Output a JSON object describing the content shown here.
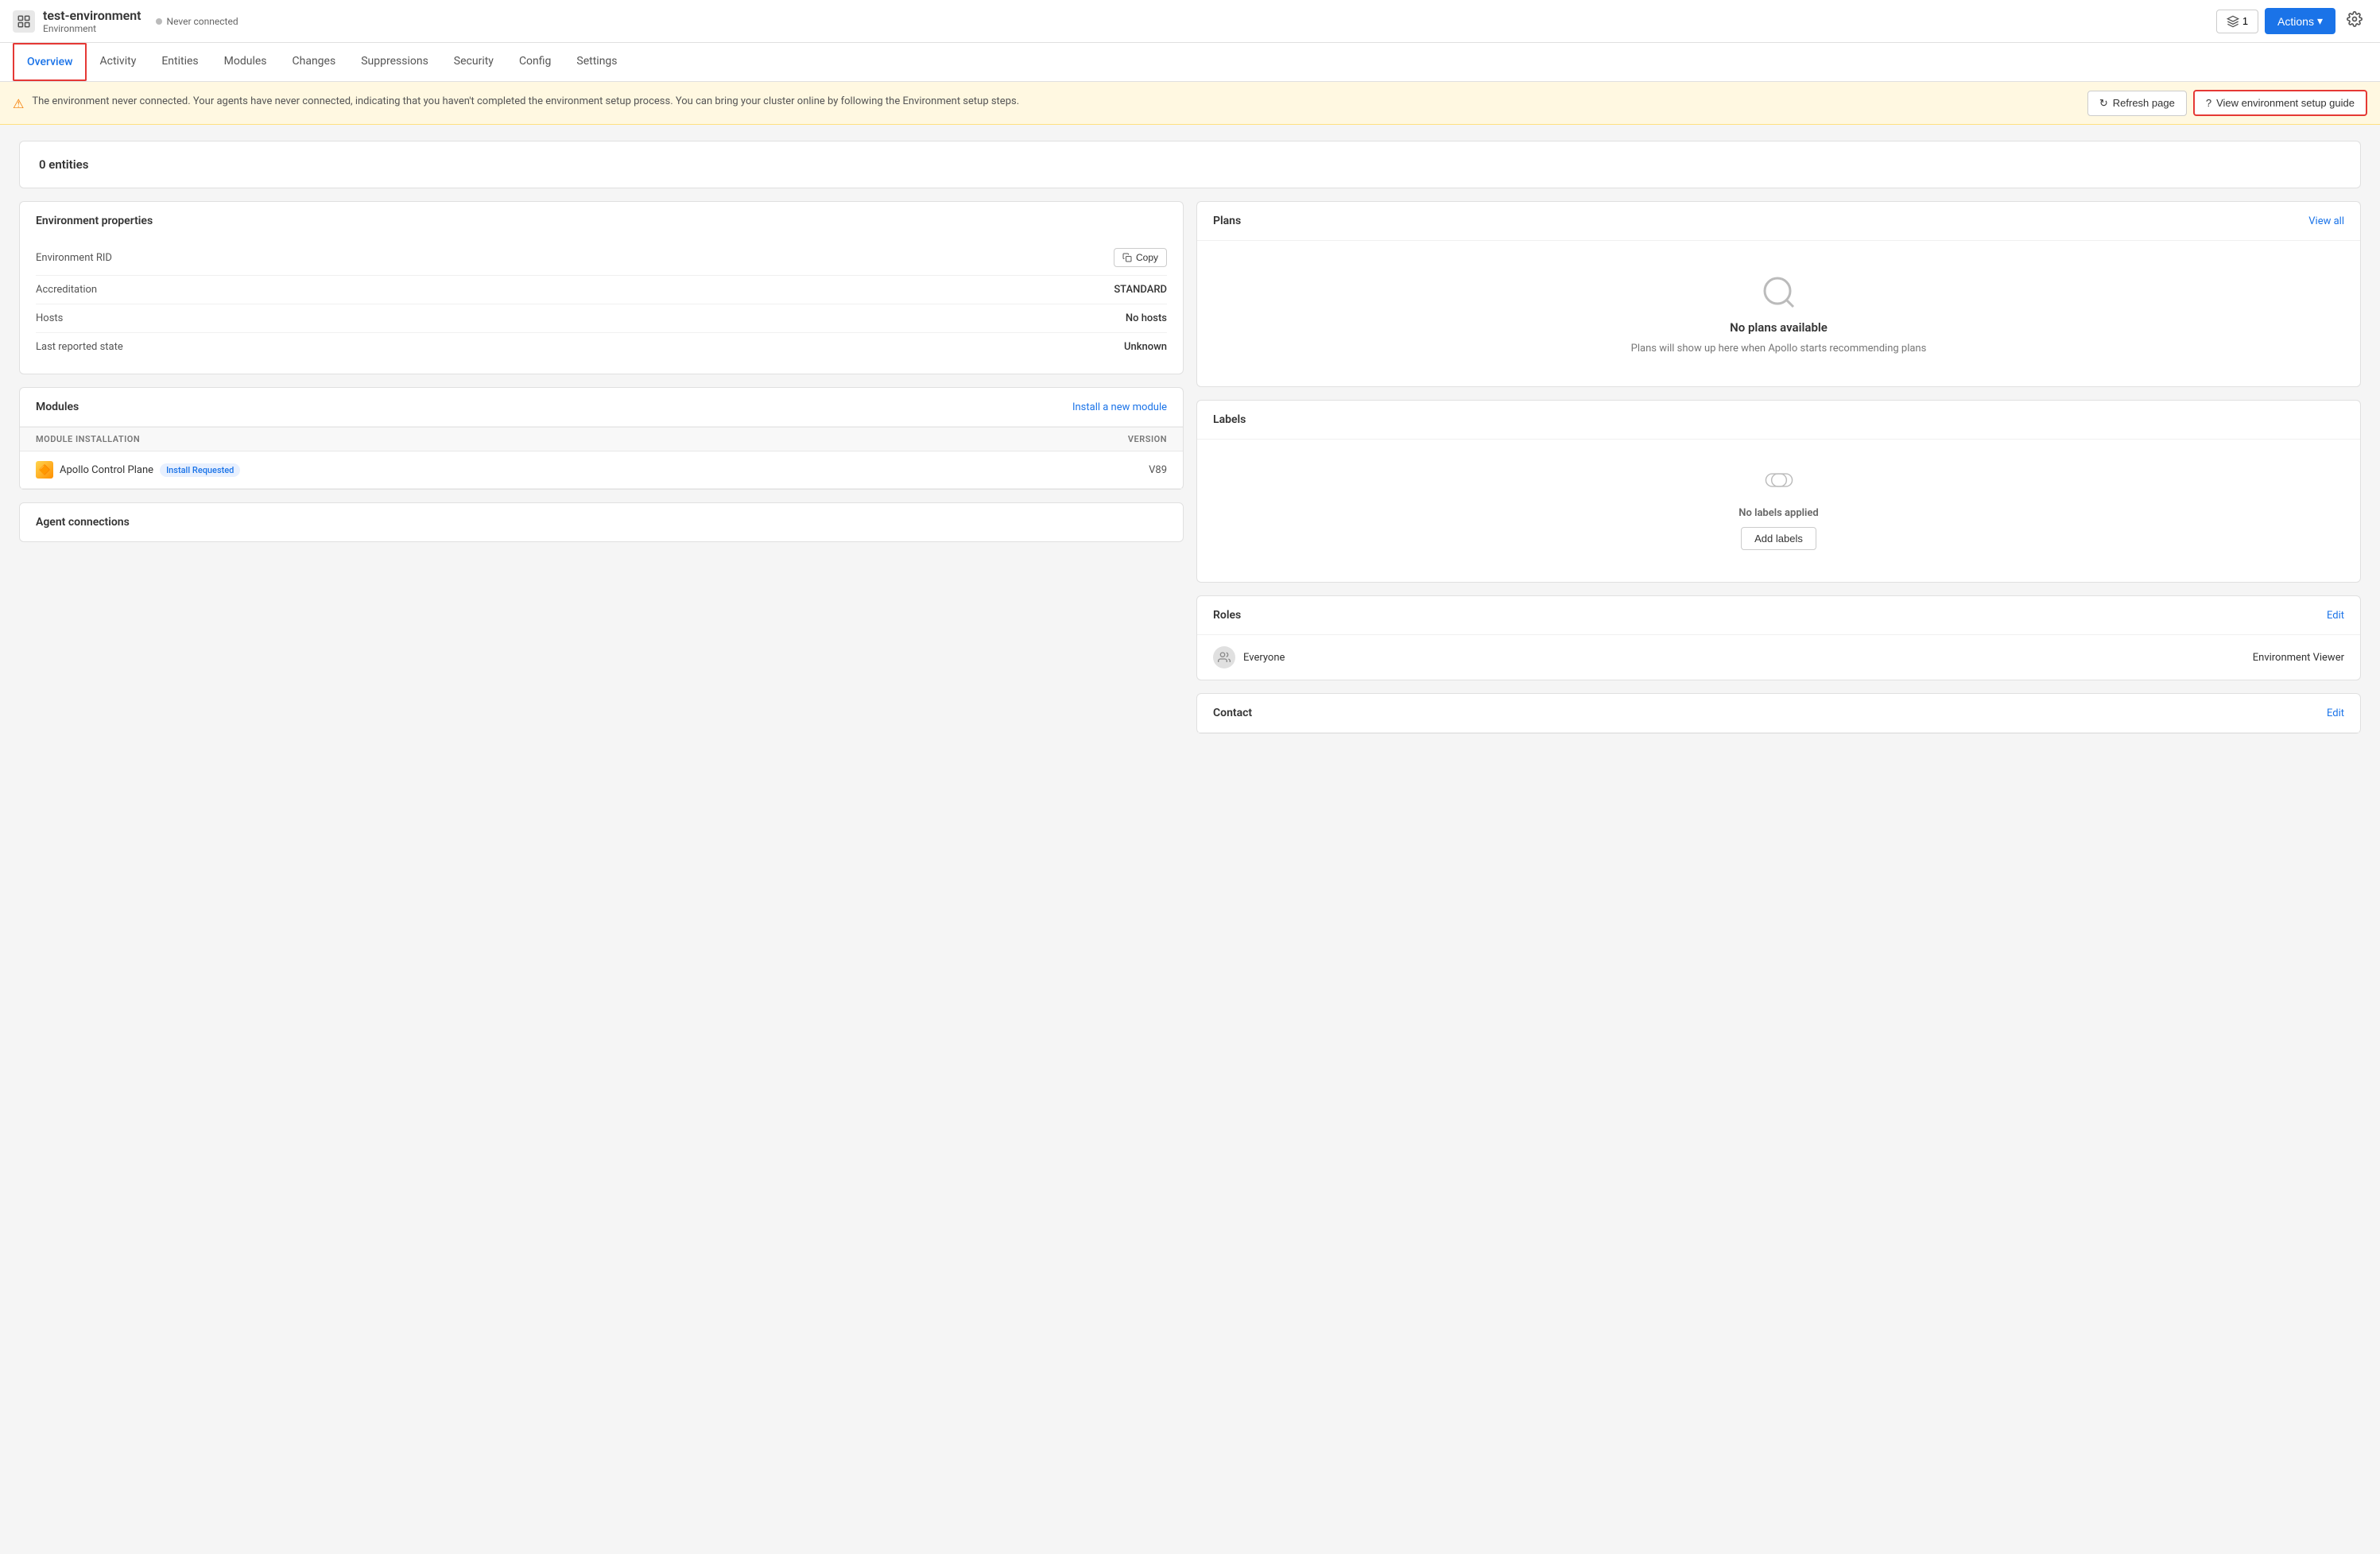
{
  "header": {
    "title": "test-environment",
    "subtitle": "Environment",
    "status": "Never connected",
    "notifications_count": "1",
    "actions_label": "Actions",
    "settings_icon": "⚙"
  },
  "tabs": [
    {
      "id": "overview",
      "label": "Overview",
      "active": true
    },
    {
      "id": "activity",
      "label": "Activity",
      "active": false
    },
    {
      "id": "entities",
      "label": "Entities",
      "active": false
    },
    {
      "id": "modules",
      "label": "Modules",
      "active": false
    },
    {
      "id": "changes",
      "label": "Changes",
      "active": false
    },
    {
      "id": "suppressions",
      "label": "Suppressions",
      "active": false
    },
    {
      "id": "security",
      "label": "Security",
      "active": false
    },
    {
      "id": "config",
      "label": "Config",
      "active": false
    },
    {
      "id": "settings",
      "label": "Settings",
      "active": false
    }
  ],
  "alert": {
    "message": "The environment never connected. Your agents have never connected, indicating that you haven't completed the environment setup process. You can bring your cluster online by following the Environment setup steps.",
    "refresh_label": "Refresh page",
    "guide_label": "View environment setup guide"
  },
  "entities_card": {
    "count": "0 entities"
  },
  "environment_properties": {
    "title": "Environment properties",
    "rows": [
      {
        "label": "Environment RID",
        "value": "",
        "has_copy": true
      },
      {
        "label": "Accreditation",
        "value": "STANDARD",
        "has_copy": false
      },
      {
        "label": "Hosts",
        "value": "No hosts",
        "has_copy": false
      },
      {
        "label": "Last reported state",
        "value": "Unknown",
        "has_copy": false
      }
    ],
    "copy_label": "Copy"
  },
  "plans": {
    "title": "Plans",
    "view_all_label": "View all",
    "empty_title": "No plans available",
    "empty_subtitle": "Plans will show up here when Apollo starts recommending plans"
  },
  "modules": {
    "title": "Modules",
    "install_link": "Install a new module",
    "col_module": "MODULE INSTALLATION",
    "col_version": "VERSION",
    "items": [
      {
        "name": "Apollo Control Plane",
        "badge": "Install Requested",
        "version": "V89"
      }
    ]
  },
  "labels": {
    "title": "Labels",
    "empty_title": "No labels applied",
    "add_label": "Add labels"
  },
  "roles": {
    "title": "Roles",
    "edit_label": "Edit",
    "rows": [
      {
        "user": "Everyone",
        "role": "Environment Viewer"
      }
    ]
  },
  "contact": {
    "title": "Contact",
    "edit_label": "Edit"
  },
  "agent_connections": {
    "title": "Agent connections"
  }
}
